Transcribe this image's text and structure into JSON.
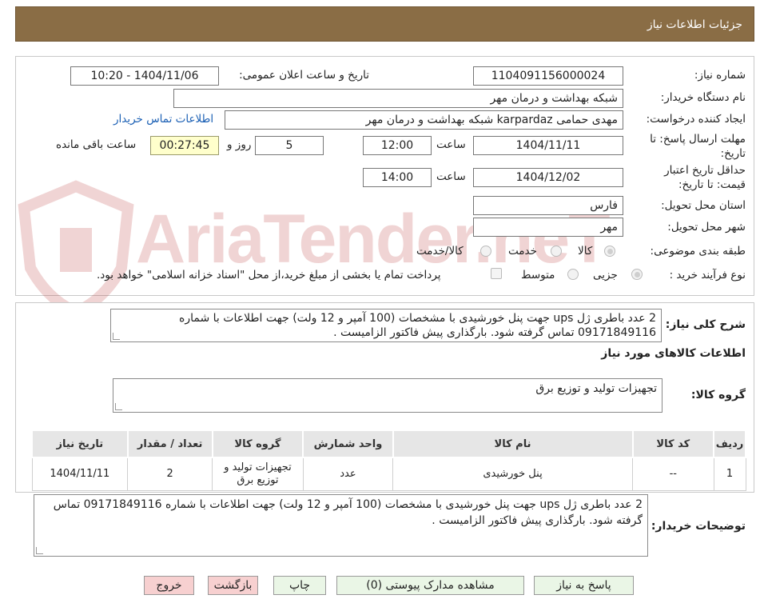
{
  "header": {
    "title": "جزئیات اطلاعات نیاز"
  },
  "watermark": {
    "text": "AriaTender.neT"
  },
  "form": {
    "need_number_label": "شماره نیاز:",
    "need_number": "1104091156000024",
    "announce_label": "تاریخ و ساعت اعلان عمومی:",
    "announce_value": "1404/11/06 - 10:20",
    "buyer_org_label": "نام دستگاه خریدار:",
    "buyer_org": "شبکه بهداشت و درمان مهر",
    "creator_label": "ایجاد کننده درخواست:",
    "creator": "مهدی حمامی karpardaz شبکه بهداشت و درمان مهر",
    "contact_link": "اطلاعات تماس خریدار",
    "deadline_label_1": "مهلت ارسال پاسخ: تا",
    "deadline_label_2": "تاریخ:",
    "deadline_date": "1404/11/11",
    "time_label": "ساعت",
    "deadline_time": "12:00",
    "days_value": "5",
    "days_label": "روز و",
    "remaining_time": "00:27:45",
    "remaining_label": "ساعت باقی مانده",
    "validity_label_1": "حداقل تاریخ اعتبار",
    "validity_label_2": "قیمت: تا تاریخ:",
    "validity_date": "1404/12/02",
    "validity_time": "14:00",
    "province_label": "استان محل تحویل:",
    "province": "فارس",
    "city_label": "شهر محل تحویل:",
    "city": "مهر",
    "category_label": "طبقه بندی موضوعی:",
    "category_options": [
      "کالا",
      "خدمت",
      "کالا/خدمت"
    ],
    "process_label": "نوع فرآیند خرید :",
    "process_options": [
      "جزیی",
      "متوسط"
    ],
    "payment_note": "پرداخت تمام یا بخشی از مبلغ خرید،از محل \"اسناد خزانه اسلامی\" خواهد بود."
  },
  "summary": {
    "label": "شرح کلی نیاز:",
    "text": "2 عدد باطری ژل ups جهت پنل خورشیدی با مشخصات (100 آمپر و 12 ولت) جهت اطلاعات با شماره 09171849116 تماس گرفته شود. بارگذاری پیش فاکتور الزامیست ."
  },
  "goods": {
    "section_title": "اطلاعات کالاهای مورد نیاز",
    "group_label": "گروه کالا:",
    "group_value": "تجهیزات تولید و توزیع برق",
    "columns": [
      "ردیف",
      "کد کالا",
      "نام کالا",
      "واحد شمارش",
      "گروه کالا",
      "تعداد / مقدار",
      "تاریخ نیاز"
    ],
    "rows": [
      [
        "1",
        "--",
        "پنل خورشیدی",
        "عدد",
        "تجهیزات تولید و توزیع برق",
        "2",
        "1404/11/11"
      ]
    ]
  },
  "buyer_notes": {
    "label": "توضیحات خریدار:",
    "text": "2 عدد باطری ژل ups جهت پنل خورشیدی با مشخصات (100 آمپر و 12 ولت) جهت اطلاعات با شماره 09171849116 تماس گرفته شود. بارگذاری پیش فاکتور الزامیست ."
  },
  "buttons": {
    "reply": "پاسخ به نیاز",
    "attachments": "مشاهده مدارک پیوستی (0)",
    "print": "چاپ",
    "back": "بازگشت",
    "exit": "خروج"
  },
  "colors": {
    "header_bg": "#8a6d45",
    "green_button": "#eaf6e6",
    "red_button": "#f7d0d0",
    "timer_bg": "#ffffcc"
  }
}
